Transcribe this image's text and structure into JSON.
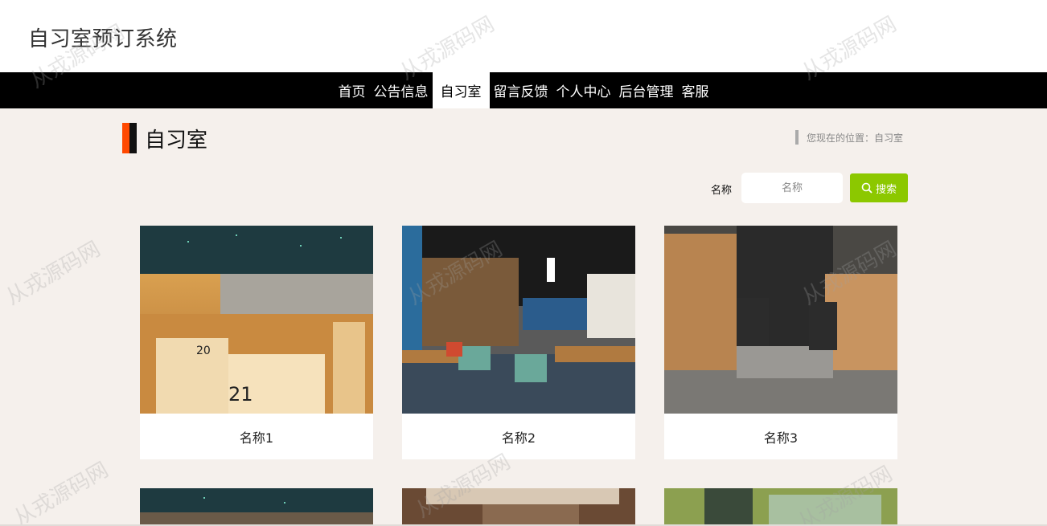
{
  "header": {
    "site_title": "自习室预订系统"
  },
  "nav": {
    "items": [
      {
        "label": "首页",
        "active": false
      },
      {
        "label": "公告信息",
        "active": false
      },
      {
        "label": "自习室",
        "active": true
      },
      {
        "label": "留言反馈",
        "active": false
      },
      {
        "label": "个人中心",
        "active": false
      },
      {
        "label": "后台管理",
        "active": false
      },
      {
        "label": "客服",
        "active": false
      }
    ]
  },
  "section": {
    "title": "自习室",
    "accent_color": "#ff4800",
    "breadcrumb": "您现在的位置：自习室"
  },
  "search": {
    "label": "名称",
    "placeholder": "名称",
    "value": "",
    "button_label": "搜索",
    "button_color": "#8cc800"
  },
  "cards": [
    {
      "name": "名称1",
      "image": "study-pods-room"
    },
    {
      "name": "名称2",
      "image": "library-cafe-room"
    },
    {
      "name": "名称3",
      "image": "cubicle-corridor-room"
    },
    {
      "name": "",
      "image": "study-pods-room"
    },
    {
      "name": "",
      "image": "wood-room"
    },
    {
      "name": "",
      "image": "green-glass-room"
    }
  ],
  "watermark": "从戎源码网"
}
